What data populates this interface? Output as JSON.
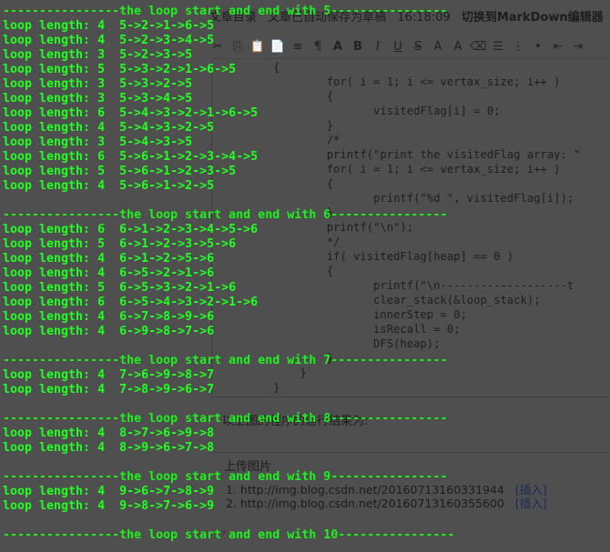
{
  "editor": {
    "topbar": {
      "tab_label": "文章目录",
      "autosave_text": "文章已自动保存为草稿",
      "time": "16:18:09",
      "switch_link": "切换到MarkDown编辑器"
    },
    "toolbar": {
      "items": [
        {
          "icon": "cut-icon",
          "glyph": "✂",
          "cls": ""
        },
        {
          "icon": "copy-icon",
          "glyph": "⎘",
          "cls": ""
        },
        {
          "icon": "paste-icon",
          "glyph": "📋",
          "cls": ""
        },
        {
          "icon": "paste-text-icon",
          "glyph": "📄",
          "cls": ""
        },
        {
          "icon": "indent-icon",
          "glyph": "≡",
          "cls": ""
        },
        {
          "icon": "format-icon",
          "glyph": "¶",
          "cls": ""
        },
        {
          "icon": "font-icon",
          "glyph": "A",
          "cls": "b"
        },
        {
          "icon": "bold-icon",
          "glyph": "B",
          "cls": "b"
        },
        {
          "icon": "italic-icon",
          "glyph": "I",
          "cls": "i"
        },
        {
          "icon": "underline-icon",
          "glyph": "U",
          "cls": "u"
        },
        {
          "icon": "strike-icon",
          "glyph": "S",
          "cls": "s"
        },
        {
          "icon": "text-color-icon",
          "glyph": "A",
          "cls": ""
        },
        {
          "icon": "bg-color-icon",
          "glyph": "A",
          "cls": ""
        },
        {
          "icon": "eraser-icon",
          "glyph": "⌫",
          "cls": ""
        },
        {
          "icon": "align-icon",
          "glyph": "☰",
          "cls": ""
        },
        {
          "icon": "ordered-list-icon",
          "glyph": "⋮",
          "cls": ""
        },
        {
          "icon": "bullet-list-icon",
          "glyph": "•",
          "cls": ""
        },
        {
          "icon": "outdent-icon",
          "glyph": "⇤",
          "cls": ""
        },
        {
          "icon": "indent-more-icon",
          "glyph": "⇥",
          "cls": ""
        }
      ]
    },
    "code_lines": [
      "{",
      "        for( i = 1; i <= vertax_size; i++ )",
      "        {",
      "               visitedFlag[i] = 0;",
      "        }",
      "        /*",
      "        printf(\"print the visitedFlag array: \"",
      "        for( i = 1; i <= vertax_size; i++ )",
      "        {",
      "               printf(\"%d \", visitedFlag[i]);",
      "        }",
      "        printf(\"\\n\");",
      "        */",
      "        if( visitedFlag[heap] == 0 )",
      "        {",
      "               printf(\"\\n-------------------t",
      "               clear_stack(&loop_stack);",
      "               innerStep = 0;",
      "               isRecall = 0;",
      "               DFS(heap);",
      "        }",
      "    }",
      "}"
    ],
    "caption": "以上图的程序的运行结果为:",
    "upload": {
      "title": "上传图片",
      "items": [
        {
          "num": "1.",
          "url": "http://img.blog.csdn.net/20160713160331944",
          "insert": "[插入]"
        },
        {
          "num": "2.",
          "url": "http://img.blog.csdn.net/20160713160355600",
          "insert": "[插入]"
        }
      ]
    }
  },
  "terminal": {
    "lines": [
      "----------------the loop start and end with 5----------------",
      "loop length: 4  5->2->1->6->5",
      "loop length: 4  5->2->3->4->5",
      "loop length: 3  5->2->3->5",
      "loop length: 5  5->3->2->1->6->5",
      "loop length: 3  5->3->2->5",
      "loop length: 3  5->3->4->5",
      "loop length: 6  5->4->3->2->1->6->5",
      "loop length: 4  5->4->3->2->5",
      "loop length: 3  5->4->3->5",
      "loop length: 6  5->6->1->2->3->4->5",
      "loop length: 5  5->6->1->2->3->5",
      "loop length: 4  5->6->1->2->5",
      "",
      "----------------the loop start and end with 6----------------",
      "loop length: 6  6->1->2->3->4->5->6",
      "loop length: 5  6->1->2->3->5->6",
      "loop length: 4  6->1->2->5->6",
      "loop length: 4  6->5->2->1->6",
      "loop length: 5  6->5->3->2->1->6",
      "loop length: 6  6->5->4->3->2->1->6",
      "loop length: 4  6->7->8->9->6",
      "loop length: 4  6->9->8->7->6",
      "",
      "----------------the loop start and end with 7----------------",
      "loop length: 4  7->6->9->8->7",
      "loop length: 4  7->8->9->6->7",
      "",
      "----------------the loop start and end with 8----------------",
      "loop length: 4  8->7->6->9->8",
      "loop length: 4  8->9->6->7->8",
      "",
      "----------------the loop start and end with 9----------------",
      "loop length: 4  9->6->7->8->9",
      "loop length: 4  9->8->7->6->9",
      "",
      "----------------the loop start and end with 10----------------"
    ]
  }
}
